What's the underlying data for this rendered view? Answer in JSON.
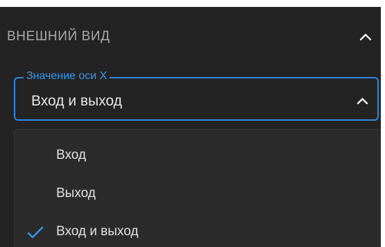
{
  "section": {
    "title": "ВНЕШНИЙ ВИД",
    "collapse_icon": "chevron-up-icon",
    "expanded": true
  },
  "x_axis_select": {
    "label": "Значение оси X",
    "value": "Вход и выход",
    "arrow_icon": "chevron-up-icon",
    "open": true
  },
  "dropdown": {
    "options": [
      {
        "label": "Вход",
        "selected": false
      },
      {
        "label": "Выход",
        "selected": false
      },
      {
        "label": "Вход и выход",
        "selected": true
      }
    ],
    "selected_icon": "checkmark-icon"
  },
  "colors": {
    "accent": "#2f8ae0",
    "panel_background": "#232323",
    "menu_background": "#2b2b2b",
    "text_primary": "#e6e6e6",
    "text_secondary": "#a9a9a9"
  }
}
